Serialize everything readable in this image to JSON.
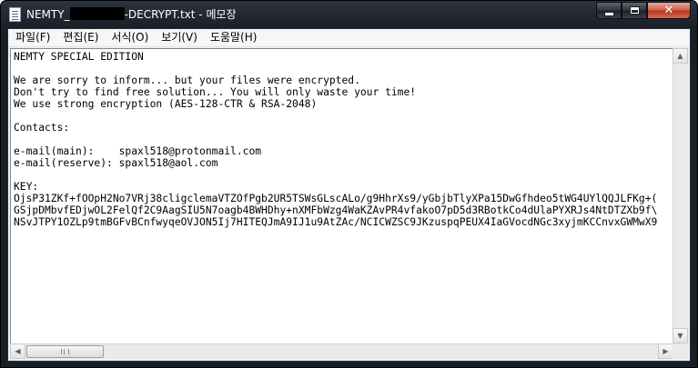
{
  "window": {
    "title_prefix": "NEMTY_",
    "title_suffix": "-DECRYPT.txt - 메모장",
    "caption_buttons": {
      "minimize_icon": "minimize-icon",
      "maximize_icon": "maximize-icon",
      "close_label": "✕"
    }
  },
  "menu": [
    {
      "label": "파일(F)"
    },
    {
      "label": "편집(E)"
    },
    {
      "label": "서식(O)"
    },
    {
      "label": "보기(V)"
    },
    {
      "label": "도움말(H)"
    }
  ],
  "document": {
    "lines": [
      "NEMTY SPECIAL EDITION",
      "",
      "We are sorry to inform... but your files were encrypted.",
      "Don't try to find free solution... You will only waste your time!",
      "We use strong encryption (AES-128-CTR & RSA-2048)",
      "",
      "Contacts:",
      "",
      "e-mail(main):    spaxl518@protonmail.com",
      "e-mail(reserve): spaxl518@aol.com",
      "",
      "KEY:",
      "OjsP31ZKf+fOOpH2No7VRj38cligclemaVTZOfPgb2UR5TSWsGLscALo/g9HhrXs9/yGbjbTlyXPa15DwGfhdeo5tWG4UYlQQJLFKg+(",
      "GSjpDMbvfEDjwOL2FelQf2C9AagSIU5N7oagb4BWHDhy+nXMFbWzg4WaKZAvPR4vfakoO7pD5d3RBotkCo4dUlaPYXRJs4NtDTZXb9f\\",
      "NSvJTPY1OZLp9tmBGFvBCnfwyqeOVJON5Ij7HITEQJmA9IJ1u9AtZAc/NCICWZSC9JKzuspqPEUX4IaGVocdNGc3xyjmKCCnvxGWMwX9"
    ]
  },
  "scrollbars": {
    "up_icon": "▲",
    "down_icon": "▼",
    "left_icon": "◀",
    "right_icon": "▶"
  }
}
